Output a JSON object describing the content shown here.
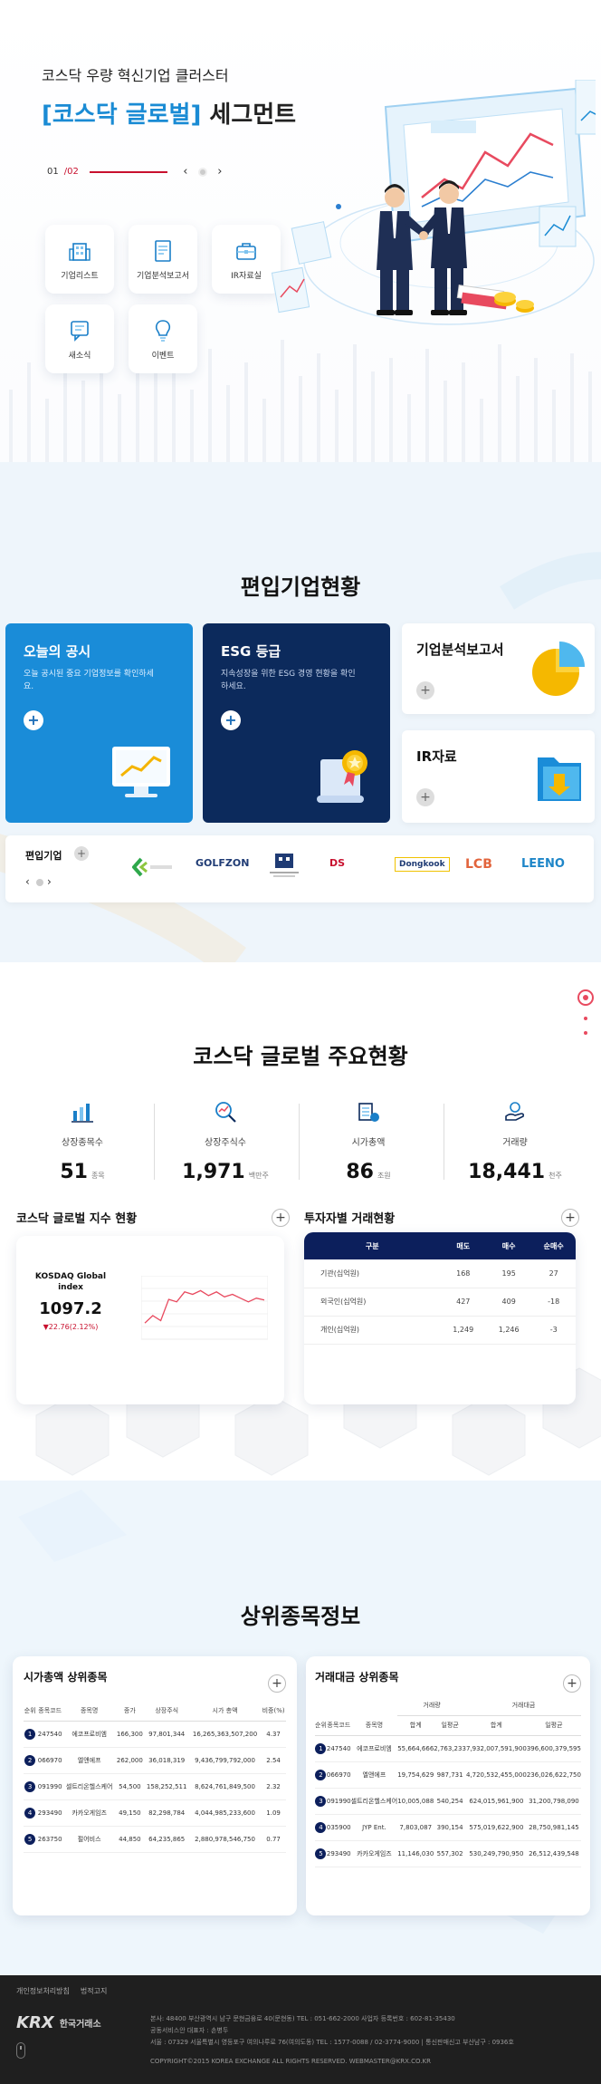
{
  "hero": {
    "subtitle": "코스닥 우량 혁신기업 클러스터",
    "title_highlight": "[코스닥 글로벌]",
    "title_rest": " 세그먼트",
    "slide_current": "01",
    "slide_total": "/02",
    "prev_icon": "‹",
    "next_icon": "›",
    "quick_links": [
      {
        "label": "기업리스트",
        "icon": "building-icon"
      },
      {
        "label": "기업분석보고서",
        "icon": "report-icon"
      },
      {
        "label": "IR자료실",
        "icon": "briefcase-icon"
      },
      {
        "label": "새소식",
        "icon": "news-icon"
      },
      {
        "label": "이벤트",
        "icon": "lightbulb-icon"
      }
    ]
  },
  "listed": {
    "title": "편입기업현황",
    "cards": {
      "disclosure": {
        "title": "오늘의 공시",
        "desc": "오늘 공시된 중요 기업정보를 확인하세요."
      },
      "esg": {
        "title": "ESG 등급",
        "desc": "지속성장을 위한 ESG 경영 현황을 확인하세요."
      },
      "report": {
        "title": "기업분석보고서"
      },
      "ir": {
        "title": "IR자료"
      }
    },
    "companies_label": "편입기업",
    "logos": [
      "GOLFZON",
      "DS",
      "Dongkook",
      "LCB",
      "LEENO"
    ],
    "colors": {
      "blue": "#1a8cd8",
      "navy": "#0c2a5c",
      "red": "#c8102e"
    }
  },
  "status": {
    "title": "코스닥 글로벌 주요현황",
    "stats": [
      {
        "label": "상장종목수",
        "value": "51",
        "unit": "종목"
      },
      {
        "label": "상장주식수",
        "value": "1,971",
        "unit": "백만주"
      },
      {
        "label": "시가총액",
        "value": "86",
        "unit": "조원"
      },
      {
        "label": "거래량",
        "value": "18,441",
        "unit": "천주"
      }
    ],
    "index_title": "코스닥 글로벌 지수 현황",
    "index_name_1": "KOSDAQ Global",
    "index_name_2": "index",
    "index_value": "1097.2",
    "index_change": "▼22.76(2.12%)",
    "investor_title": "투자자별 거래현황",
    "investor_headers": [
      "구분",
      "매도",
      "매수",
      "순매수"
    ],
    "investor_rows": [
      [
        "기관(십억원)",
        "168",
        "195",
        "27"
      ],
      [
        "외국인(십억원)",
        "427",
        "409",
        "-18"
      ],
      [
        "개인(십억원)",
        "1,249",
        "1,246",
        "-3"
      ]
    ]
  },
  "chart_data": {
    "type": "line",
    "title": "",
    "xlabel": "",
    "ylabel": "",
    "series": [
      {
        "values": [
          1060,
          1072,
          1064,
          1098,
          1094,
          1110,
          1106,
          1112,
          1104,
          1110,
          1102,
          1106,
          1100,
          1094,
          1100,
          1097
        ]
      }
    ],
    "ylim": [
      1040,
      1130
    ],
    "grid": true
  },
  "top": {
    "title": "상위종목정보",
    "mcap": {
      "title": "시가총액 상위종목",
      "headers": [
        "순위",
        "종목코드",
        "종목명",
        "종가",
        "상장주식",
        "시가 총액",
        "비중(%)"
      ],
      "rows": [
        [
          "1",
          "247540",
          "에코프로비엠",
          "166,300",
          "97,801,344",
          "16,265,363,507,200",
          "4.37"
        ],
        [
          "2",
          "066970",
          "엘앤에프",
          "262,000",
          "36,018,319",
          "9,436,799,792,000",
          "2.54"
        ],
        [
          "3",
          "091990",
          "셀트리온헬스케어",
          "54,500",
          "158,252,511",
          "8,624,761,849,500",
          "2.32"
        ],
        [
          "4",
          "293490",
          "카카오게임즈",
          "49,150",
          "82,298,784",
          "4,044,985,233,600",
          "1.09"
        ],
        [
          "5",
          "263750",
          "펄어비스",
          "44,850",
          "64,235,865",
          "2,880,978,546,750",
          "0.77"
        ]
      ]
    },
    "value": {
      "title": "거래대금 상위종목",
      "group_volume": "거래량",
      "group_amount": "거래대금",
      "headers": [
        "순위",
        "종목코드",
        "종목명",
        "합계",
        "일평균",
        "합계",
        "일평균"
      ],
      "rows": [
        [
          "1",
          "247540",
          "에코프로비엠",
          "55,664,666",
          "2,763,233",
          "7,932,007,591,900",
          "396,600,379,595"
        ],
        [
          "2",
          "066970",
          "엘앤에프",
          "19,754,629",
          "987,731",
          "4,720,532,455,000",
          "236,026,622,750"
        ],
        [
          "3",
          "091990",
          "셀트리온헬스케어",
          "10,005,088",
          "540,254",
          "624,015,961,900",
          "31,200,798,090"
        ],
        [
          "4",
          "035900",
          "JYP Ent.",
          "7,803,087",
          "390,154",
          "575,019,622,900",
          "28,750,981,145"
        ],
        [
          "5",
          "293490",
          "카카오게임즈",
          "11,146,030",
          "557,302",
          "530,249,790,950",
          "26,512,439,548"
        ]
      ]
    }
  },
  "footer": {
    "links": [
      "개인정보처리방침",
      "법적고지"
    ],
    "logo": "KRX",
    "logo_kr": "한국거래소",
    "line1": "본사: 48400 부산광역시 남구 문현금융로 40(문현동) TEL : 051-662-2000 사업자 등록번호 : 602-81-35430",
    "line2": "공동서비스안 대표자 : 손병두",
    "line3": "서울 : 07329 서울특별시 영등포구 여의나루로 76(여의도동) TEL : 1577-0088 / 02-3774-9000 | 통신판매신고 부산남구 : 0936호",
    "copyright": "COPYRIGHT©2015 KOREA EXCHANGE ALL RIGHTS RESERVED. WEBMASTER@KRX.CO.KR"
  }
}
